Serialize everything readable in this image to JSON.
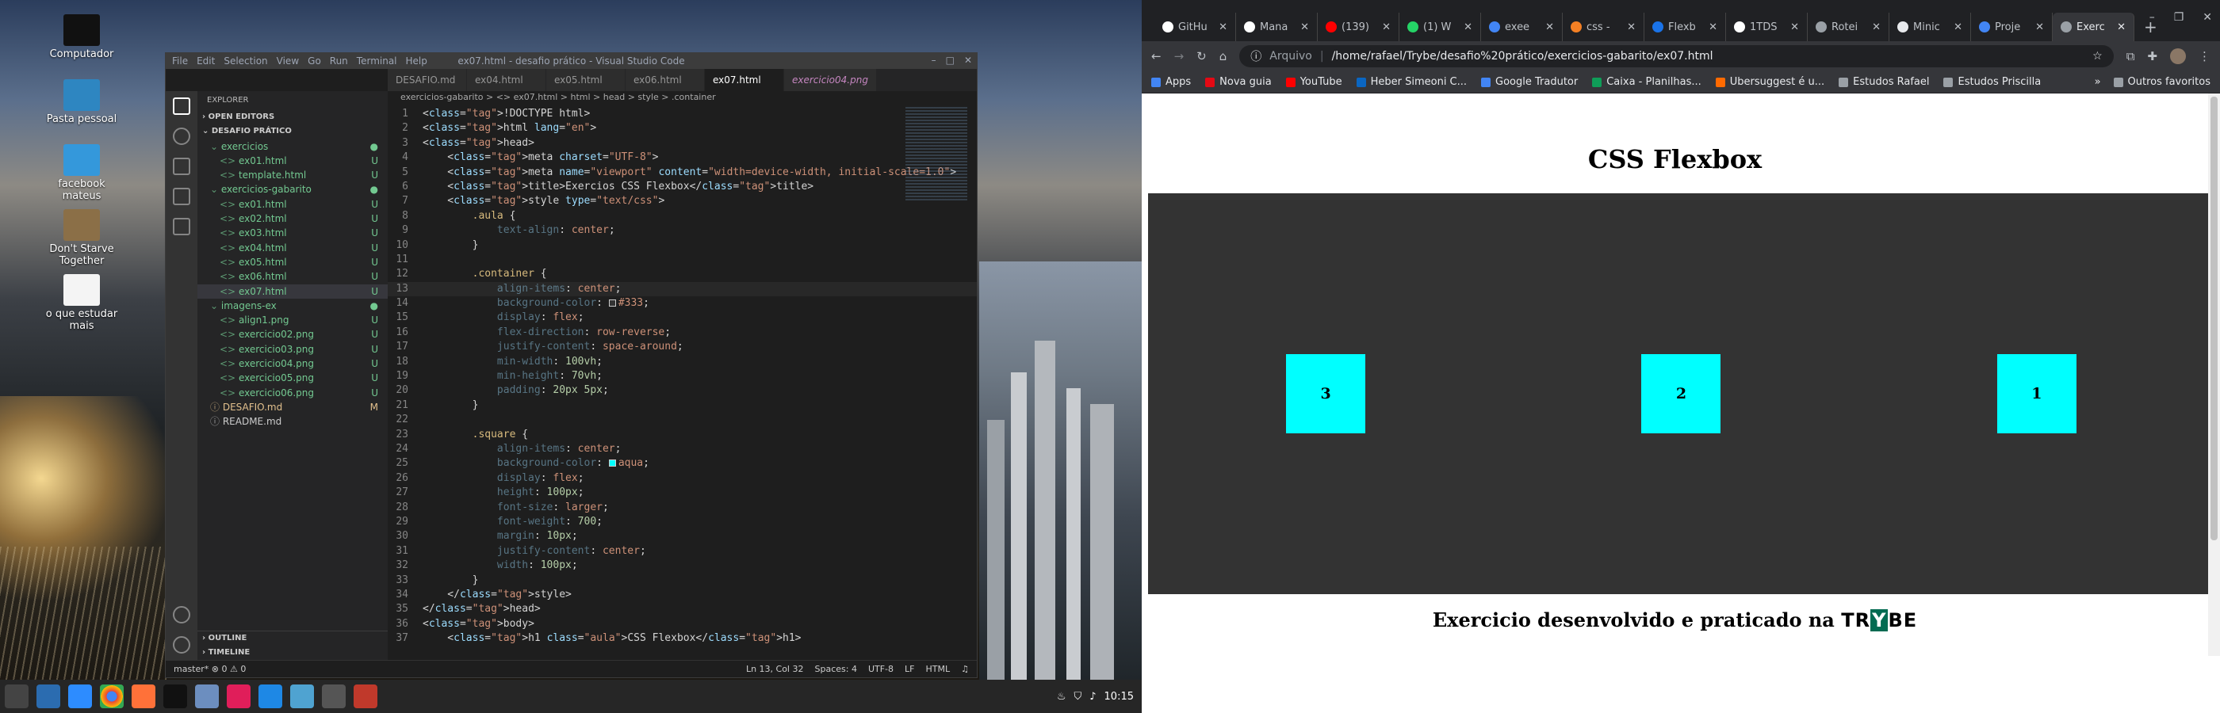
{
  "desktop": {
    "icons": [
      {
        "label": "Computador",
        "icon": "monitor-icon"
      },
      {
        "label": "Pasta pessoal",
        "icon": "home-folder-icon"
      },
      {
        "label": "facebook mateus",
        "icon": "folder-icon"
      },
      {
        "label": "Don't Starve Together",
        "icon": "game-icon"
      },
      {
        "label": "o que estudar mais",
        "icon": "text-file-icon"
      }
    ]
  },
  "vscode": {
    "title": "ex07.html - desafio prático - Visual Studio Code",
    "menu": [
      "File",
      "Edit",
      "Selection",
      "View",
      "Go",
      "Run",
      "Terminal",
      "Help"
    ],
    "explorer": {
      "header": "EXPLORER",
      "open_editors": "OPEN EDITORS",
      "root": "DESAFIO PRÁTICO",
      "rows": [
        {
          "label": "exercicios",
          "kind": "folder",
          "depth": 1,
          "status": "●"
        },
        {
          "label": "ex01.html",
          "kind": "file",
          "depth": 2,
          "status": "U"
        },
        {
          "label": "template.html",
          "kind": "file",
          "depth": 2,
          "status": "U"
        },
        {
          "label": "exercicios-gabarito",
          "kind": "folder",
          "depth": 1,
          "status": "●"
        },
        {
          "label": "ex01.html",
          "kind": "file",
          "depth": 2,
          "status": "U"
        },
        {
          "label": "ex02.html",
          "kind": "file",
          "depth": 2,
          "status": "U"
        },
        {
          "label": "ex03.html",
          "kind": "file",
          "depth": 2,
          "status": "U"
        },
        {
          "label": "ex04.html",
          "kind": "file",
          "depth": 2,
          "status": "U"
        },
        {
          "label": "ex05.html",
          "kind": "file",
          "depth": 2,
          "status": "U"
        },
        {
          "label": "ex06.html",
          "kind": "file",
          "depth": 2,
          "status": "U"
        },
        {
          "label": "ex07.html",
          "kind": "file",
          "depth": 2,
          "status": "U",
          "selected": true
        },
        {
          "label": "imagens-ex",
          "kind": "folder",
          "depth": 1,
          "status": "●"
        },
        {
          "label": "align1.png",
          "kind": "file",
          "depth": 2,
          "status": "U"
        },
        {
          "label": "exercicio02.png",
          "kind": "file",
          "depth": 2,
          "status": "U"
        },
        {
          "label": "exercicio03.png",
          "kind": "file",
          "depth": 2,
          "status": "U"
        },
        {
          "label": "exercicio04.png",
          "kind": "file",
          "depth": 2,
          "status": "U"
        },
        {
          "label": "exercicio05.png",
          "kind": "file",
          "depth": 2,
          "status": "U"
        },
        {
          "label": "exercicio06.png",
          "kind": "file",
          "depth": 2,
          "status": "U"
        },
        {
          "label": "DESAFIO.md",
          "kind": "md",
          "depth": 1,
          "status": "M"
        },
        {
          "label": "README.md",
          "kind": "md",
          "depth": 1,
          "status": ""
        }
      ],
      "outline": "OUTLINE",
      "timeline": "TIMELINE"
    },
    "tabs": [
      "DESAFIO.md",
      "ex04.html",
      "ex05.html",
      "ex06.html",
      "ex07.html",
      "exercicio04.png"
    ],
    "active_tab": "ex07.html",
    "breadcrumb": "exercicios-gabarito > <> ex07.html > html > head > style > .container",
    "code_lines": [
      "<!DOCTYPE html>",
      "<html lang=\"en\">",
      "<head>",
      "    <meta charset=\"UTF-8\">",
      "    <meta name=\"viewport\" content=\"width=device-width, initial-scale=1.0\">",
      "    <title>Exercios CSS Flexbox</title>",
      "    <style type=\"text/css\">",
      "        .aula {",
      "            text-align: center;",
      "        }",
      "",
      "        .container {",
      "            align-items: center;",
      "            background-color: #333;",
      "            display: flex;",
      "            flex-direction: row-reverse;",
      "            justify-content: space-around;",
      "            min-width: 100vh;",
      "            min-height: 70vh;",
      "            padding: 20px 5px;",
      "        }",
      "",
      "        .square {",
      "            align-items: center;",
      "            background-color: aqua;",
      "            display: flex;",
      "            height: 100px;",
      "            font-size: larger;",
      "            font-weight: 700;",
      "            margin: 10px;",
      "            justify-content: center;",
      "            width: 100px;",
      "        }",
      "    </style>",
      "</head>",
      "<body>",
      "    <h1 class=\"aula\">CSS Flexbox</h1>"
    ],
    "current_line": 13,
    "status_left": "master*   ⊗ 0 ⚠ 0",
    "status_right": [
      "Ln 13, Col 32",
      "Spaces: 4",
      "UTF-8",
      "LF",
      "HTML"
    ]
  },
  "taskbar": {
    "time": "10:15",
    "apps": [
      "menu-icon",
      "files-icon",
      "zoom-icon",
      "chrome-icon",
      "firefox-icon",
      "terminal-icon",
      "folder-icon",
      "slack-icon",
      "vscode-icon",
      "monitor-app-icon",
      "inkscape-icon",
      "kdenlive-icon"
    ]
  },
  "chrome": {
    "tabs": [
      {
        "title": "GitHu",
        "color": "#ffffff"
      },
      {
        "title": "Mana",
        "color": "#ffffff"
      },
      {
        "title": "(139)",
        "color": "#ff0000"
      },
      {
        "title": "(1) W",
        "color": "#25d366"
      },
      {
        "title": "exee",
        "color": "#4285f4"
      },
      {
        "title": "css -",
        "color": "#f48024"
      },
      {
        "title": "Flexb",
        "color": "#1a73e8"
      },
      {
        "title": "1TDS",
        "color": "#ffffff"
      },
      {
        "title": "Rotei",
        "color": "#9aa0a6"
      },
      {
        "title": "Minic",
        "color": "#e8eaed"
      },
      {
        "title": "Proje",
        "color": "#4285f4"
      },
      {
        "title": "Exerc",
        "color": "#9aa0a6",
        "active": true
      }
    ],
    "address_label": "Arquivo",
    "url": "/home/rafael/Trybe/desafio%20prático/exercicios-gabarito/ex07.html",
    "bookmarks": [
      {
        "label": "Apps",
        "color": "#4285f4"
      },
      {
        "label": "Nova guia",
        "color": "#e50914"
      },
      {
        "label": "YouTube",
        "color": "#ff0000"
      },
      {
        "label": "Heber Simeoni C...",
        "color": "#0a66c2"
      },
      {
        "label": "Google Tradutor",
        "color": "#4285f4"
      },
      {
        "label": "Caixa - Planilhas...",
        "color": "#0f9d58"
      },
      {
        "label": "Ubersuggest é u...",
        "color": "#ff6a00"
      },
      {
        "label": "Estudos Rafael",
        "color": "#9aa0a6"
      },
      {
        "label": "Estudos Priscilla",
        "color": "#9aa0a6"
      }
    ],
    "more_bookmarks": "Outros favoritos"
  },
  "page": {
    "heading": "CSS Flexbox",
    "squares": [
      "1",
      "2",
      "3"
    ],
    "footer_text": "Exercicio desenvolvido e praticado na",
    "brand_pre": "TR",
    "brand_y": "Y",
    "brand_post": "BE"
  }
}
